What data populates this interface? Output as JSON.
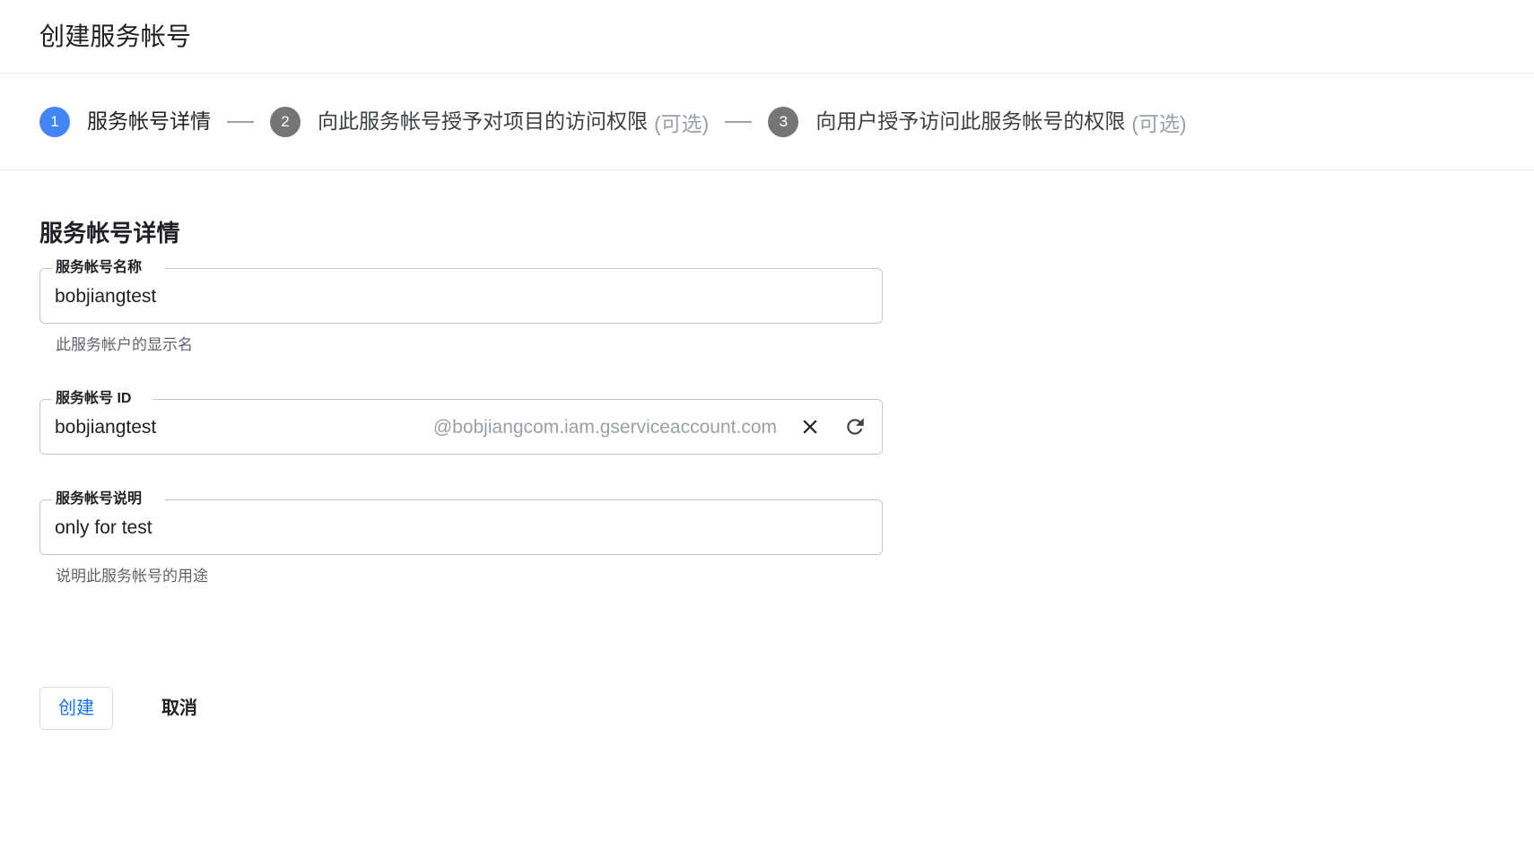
{
  "header": {
    "title": "创建服务帐号"
  },
  "stepper": {
    "separator": "—",
    "steps": [
      {
        "number": "1",
        "label": "服务帐号详情",
        "optional": "",
        "state": "active"
      },
      {
        "number": "2",
        "label": "向此服务帐号授予对项目的访问权限",
        "optional": "(可选)",
        "state": "inactive"
      },
      {
        "number": "3",
        "label": "向用户授予访问此服务帐号的权限",
        "optional": "(可选)",
        "state": "inactive"
      }
    ]
  },
  "main": {
    "section_title": "服务帐号详情",
    "fields": {
      "name": {
        "label": "服务帐号名称",
        "value": "bobjiangtest",
        "helper": "此服务帐户的显示名"
      },
      "id": {
        "label": "服务帐号 ID",
        "value": "bobjiangtest",
        "suffix": "@bobjiangcom.iam.gserviceaccount.com",
        "clear_icon": "close-icon",
        "refresh_icon": "refresh-icon"
      },
      "description": {
        "label": "服务帐号说明",
        "value": "only for test",
        "helper": "说明此服务帐号的用途"
      }
    }
  },
  "actions": {
    "create_label": "创建",
    "cancel_label": "取消"
  },
  "colors": {
    "accent_blue": "#4285f4",
    "link_blue": "#1a73e8",
    "step_inactive": "#757575",
    "muted_text": "#9aa0a6",
    "border": "#c4c7c5"
  }
}
